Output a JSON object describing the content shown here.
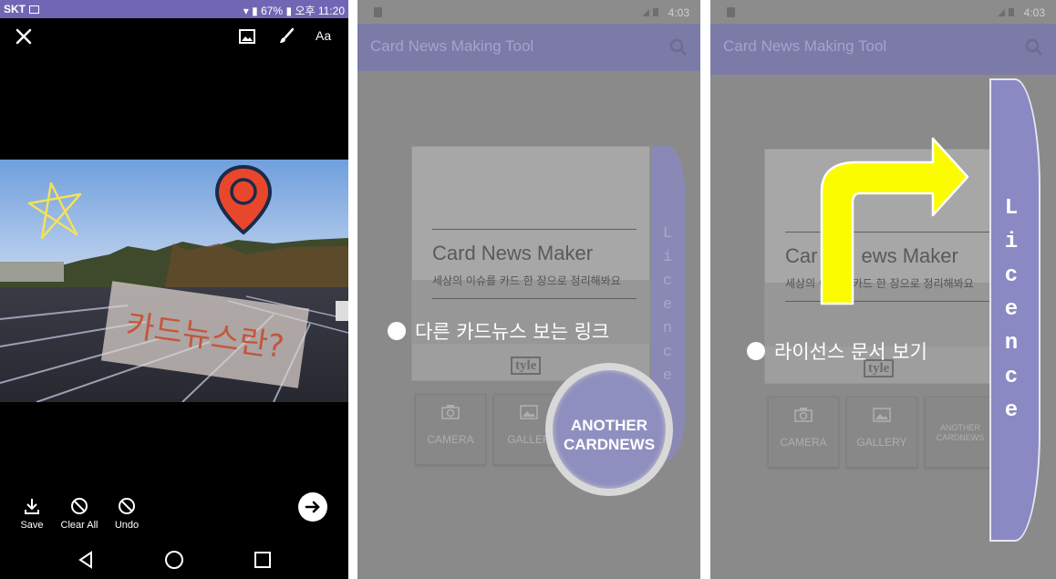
{
  "panel1": {
    "status": {
      "carrier": "SKT",
      "battery": "67%",
      "time": "오후 11:20"
    },
    "top_actions": {
      "close_icon": "close-icon",
      "image_icon": "image-icon",
      "brush_icon": "brush-icon",
      "text_label": "Aa"
    },
    "photo_text": "카드뉴스란?",
    "bottom_tools": [
      {
        "label": "Save",
        "icon": "save-icon"
      },
      {
        "label": "Clear All",
        "icon": "clear-icon"
      },
      {
        "label": "Undo",
        "icon": "undo-icon"
      }
    ],
    "colors": {
      "statusbar": "#6f67b4",
      "pin": "#e8472b",
      "star": "#f2e15a",
      "sticker_text": "#c5563a"
    }
  },
  "panel2": {
    "status": {
      "time": "4:03"
    },
    "app_title": "Card News Making Tool",
    "card": {
      "title": "Card News Maker",
      "subtitle": "세상의 이슈를 카드 한 장으로 정리해봐요",
      "logo": "tyle"
    },
    "buttons": {
      "camera": "CAMERA",
      "gallery": "GALLER"
    },
    "magnifier_text": [
      "ANOTHER",
      "CARDNEWS"
    ],
    "caption": "다른 카드뉴스 보는 링크",
    "side_tab_letters": [
      "L",
      "i",
      "c",
      "e",
      "n",
      "c",
      "e"
    ]
  },
  "panel3": {
    "status": {
      "time": "4:03"
    },
    "app_title": "Card News Making Tool",
    "card": {
      "title_start": "Car",
      "title_end": "ews Maker",
      "subtitle": "세상의 이슈를 카드 한 장으로 정리해봐요",
      "logo": "tyle"
    },
    "buttons": {
      "camera": "CAMERA",
      "gallery": "GALLERY",
      "another": [
        "ANOTHER",
        "CARDNEWS"
      ]
    },
    "caption": "라이선스 문서 보기",
    "side_tab_letters": [
      "L",
      "i",
      "c",
      "e",
      "n",
      "c",
      "e"
    ],
    "colors": {
      "arrow": "#fbfc00",
      "tab": "#8a89c4"
    }
  }
}
